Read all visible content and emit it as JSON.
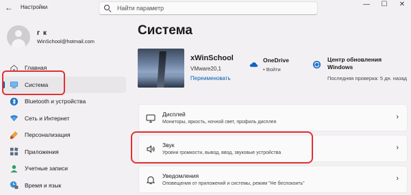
{
  "window": {
    "app_title": "Настройки",
    "back_icon": "back-arrow-icon",
    "controls": [
      "—",
      "☐",
      "✕"
    ]
  },
  "search": {
    "placeholder": "Найти параметр"
  },
  "profile": {
    "name": "г к",
    "email": "WinSchool@hotmail.com"
  },
  "sidebar": {
    "items": [
      {
        "label": "Главная",
        "icon": "home-icon",
        "active": false
      },
      {
        "label": "Система",
        "icon": "system-display-icon",
        "active": true
      },
      {
        "label": "Bluetooth и устройства",
        "icon": "bluetooth-icon",
        "active": false
      },
      {
        "label": "Сеть и Интернет",
        "icon": "wifi-icon",
        "active": false
      },
      {
        "label": "Персонализация",
        "icon": "personalization-brush-icon",
        "active": false
      },
      {
        "label": "Приложения",
        "icon": "apps-icon",
        "active": false
      },
      {
        "label": "Учетные записи",
        "icon": "accounts-icon",
        "active": false
      },
      {
        "label": "Время и язык",
        "icon": "time-language-icon",
        "active": false
      }
    ]
  },
  "main": {
    "title": "Система",
    "device": {
      "name": "xWinSchool",
      "model": "VMware20,1",
      "rename_link": "Переименовать"
    },
    "onedrive": {
      "title": "OneDrive",
      "status": "• Войти"
    },
    "windows_update": {
      "title": "Центр обновления Windows",
      "status": "Последняя проверка: 5 дн. назад"
    },
    "cards": [
      {
        "title": "Дисплей",
        "desc": "Мониторы, яркость, ночной свет, профиль дисплея",
        "icon": "display-monitor-icon"
      },
      {
        "title": "Звук",
        "desc": "Уровни громкости, вывод, ввод, звуковые устройства",
        "icon": "speaker-sound-icon"
      },
      {
        "title": "Уведомления",
        "desc": "Оповещения от приложений и системы, режим \"Не беспокоить\"",
        "icon": "notification-bell-icon"
      }
    ]
  },
  "colors": {
    "accent": "#005fb8",
    "highlight": "#e03030",
    "background": "#f3f0f3"
  }
}
